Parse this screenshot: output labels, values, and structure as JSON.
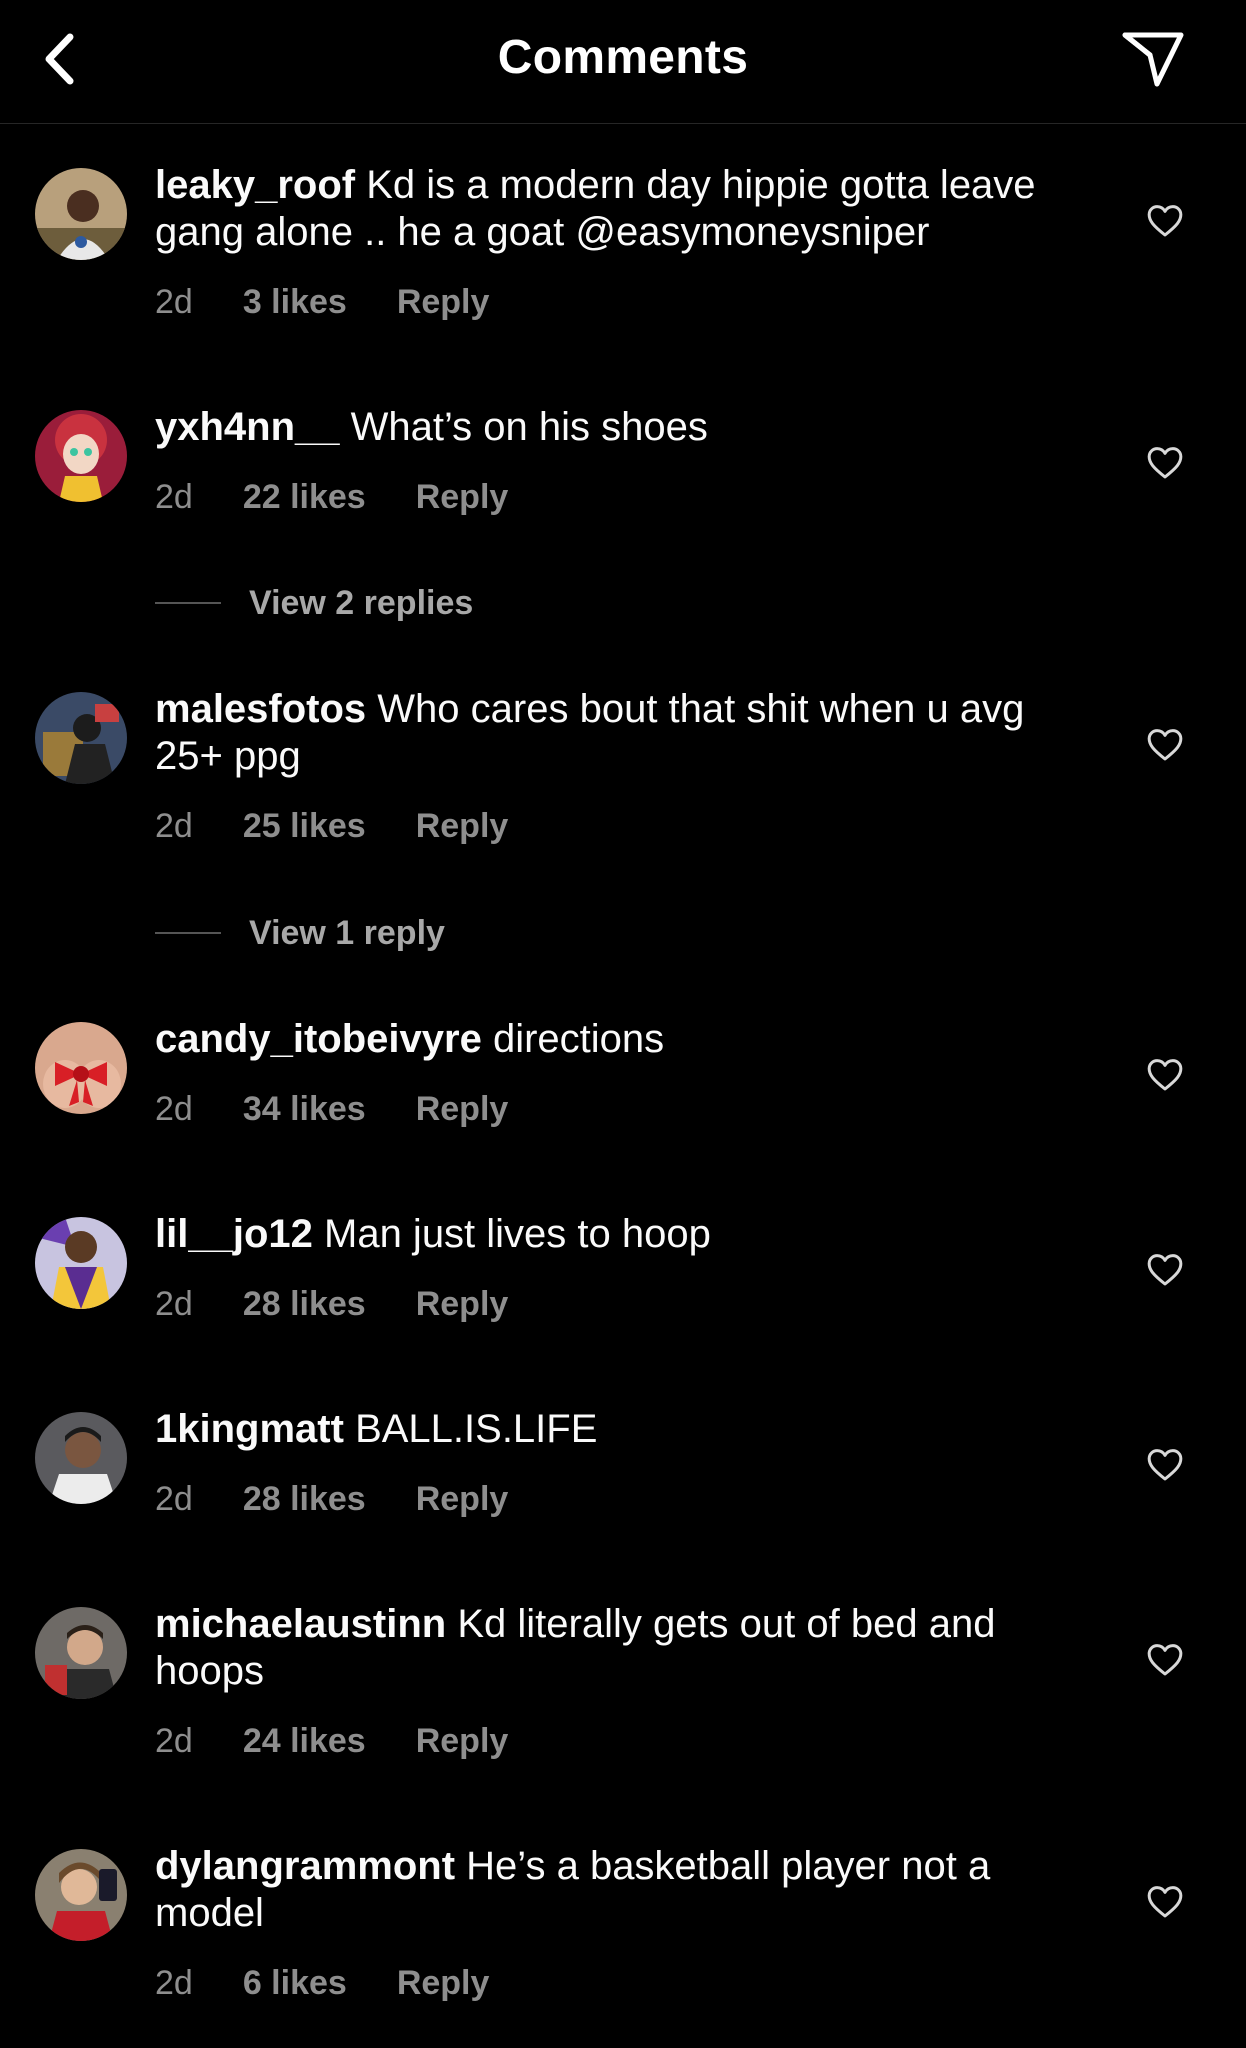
{
  "header": {
    "title": "Comments",
    "back_icon": "chevron-left-icon",
    "share_icon": "paper-plane-icon"
  },
  "colors": {
    "background": "#000000",
    "text": "#fafafa",
    "secondary": "#8e8e8e",
    "divider": "#262626"
  },
  "comments": [
    {
      "username": "leaky_roof",
      "text": "Kd is a modern day hippie gotta leave gang alone .. he a goat @easymoneysniper",
      "time": "2d",
      "likes": "3 likes",
      "reply": "Reply"
    },
    {
      "username": "yxh4nn__",
      "text": "What’s on his shoes",
      "time": "2d",
      "likes": "22 likes",
      "reply": "Reply",
      "view_replies": "View 2 replies"
    },
    {
      "username": "malesfotos",
      "text": "Who cares bout that shit when u avg 25+ ppg",
      "time": "2d",
      "likes": "25 likes",
      "reply": "Reply",
      "view_replies": "View 1 reply"
    },
    {
      "username": "candy_itobeivyre",
      "text": "directions",
      "time": "2d",
      "likes": "34 likes",
      "reply": "Reply"
    },
    {
      "username": "lil__jo12",
      "text": "Man just lives to hoop",
      "time": "2d",
      "likes": "28 likes",
      "reply": "Reply"
    },
    {
      "username": "1kingmatt",
      "text": "BALL.IS.LIFE",
      "time": "2d",
      "likes": "28 likes",
      "reply": "Reply"
    },
    {
      "username": "michaelaustinn",
      "text": "Kd literally gets out of bed and hoops",
      "time": "2d",
      "likes": "24 likes",
      "reply": "Reply"
    },
    {
      "username": "dylangrammont",
      "text": "He’s a basketball player not a model",
      "time": "2d",
      "likes": "6 likes",
      "reply": "Reply"
    }
  ]
}
